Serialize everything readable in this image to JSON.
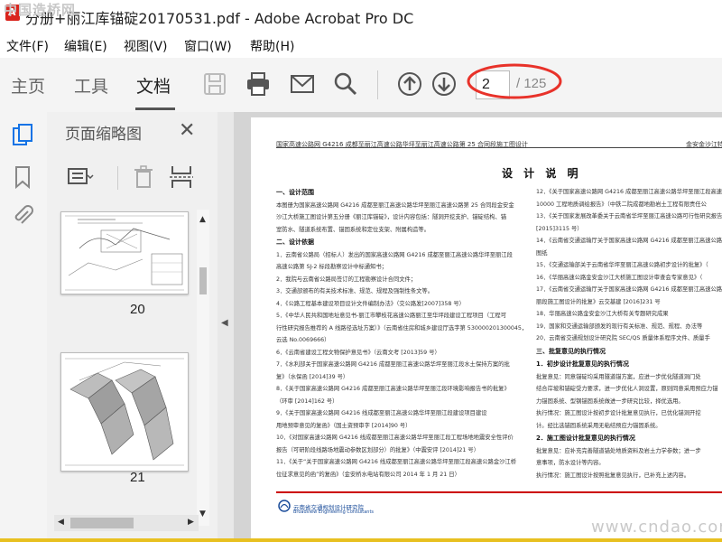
{
  "window": {
    "title": "分册+丽江库锚碇20170531.pdf - Adobe Acrobat Pro DC",
    "watermark_top": "中国造桥网",
    "watermark_bottom": "www.cndao.com"
  },
  "menu": [
    "文件(F)",
    "编辑(E)",
    "视图(V)",
    "窗口(W)",
    "帮助(H)"
  ],
  "tabs": [
    {
      "label": "主页",
      "active": false
    },
    {
      "label": "工具",
      "active": false
    },
    {
      "label": "文档",
      "active": true
    }
  ],
  "toolbar_icons": [
    "save-icon",
    "print-icon",
    "mail-icon",
    "search-icon",
    "page-up-icon",
    "page-down-icon"
  ],
  "page_nav": {
    "current": "2",
    "total_text": "/ 125"
  },
  "thumbnails": {
    "title": "页面缩略图",
    "pages": [
      "20",
      "21"
    ]
  },
  "document": {
    "header_left": "国家高速公路网 G4216 成都至丽江高速公路华坪至丽江高速公路第 25 合同段施工图设计",
    "header_right": "金安金沙江特",
    "title": "设 计 说 明",
    "left_col": [
      {
        "type": "head",
        "text": "一、设计范围"
      },
      {
        "type": "text",
        "text": "本图册为国家高速公路网 G4216 成都至丽江高速公路华坪至丽江高速公路第 25 合同段金安金"
      },
      {
        "type": "text",
        "text": "沙江大桥施工图设计第五分册《丽江库锚碇》，设计内容包括：隧洞开挖支护、锚碇结构、锚"
      },
      {
        "type": "text",
        "text": "室防水、隧道系统布置、锚固系统和定位支架、附属构造等。"
      },
      {
        "type": "head",
        "text": "二、设计依据"
      },
      {
        "type": "text",
        "text": "1．云南省公路局（招标人）发出的国家高速公路网 G4216 成都至丽江高速公路华坪至丽江段"
      },
      {
        "type": "text",
        "text": "高速公路第 SJ-2 标段勘察设计中标通知书；"
      },
      {
        "type": "text",
        "text": "2．我院与云南省公路局签订的工程勘察设计合同文件；"
      },
      {
        "type": "text",
        "text": "3．交通部颁布的有关技术标准、规范、规程及强制性条文等。"
      },
      {
        "type": "text",
        "text": "4．《公路工程基本建设项目设计文件编制办法》（交公路发[2007]358 号）"
      },
      {
        "type": "text",
        "text": "5．《中华人民共和国地址意见书-丽江市攀枝花高速公路丽江至华坪段建设工程项目（工程可"
      },
      {
        "type": "text",
        "text": "行性研究报告推荐的 A 线路径选址方案）》（云南省住房和城乡建设厅选字第 530000201300045，"
      },
      {
        "type": "text",
        "text": "云选 No.0069666）"
      },
      {
        "type": "text",
        "text": "6．《云南省建设工程文物保护意见书》（云南文考 [2013]59 号）"
      },
      {
        "type": "text",
        "text": "7．《水利部关于国家高速公路网 G4216 成都至丽江高速公路华坪至丽江段水土保持方案的批"
      },
      {
        "type": "text",
        "text": "复》（水保函 [2014]39 号）"
      },
      {
        "type": "text",
        "text": "8．《关于国家高速公路网 G4216 成都至丽江高速公路华坪至丽江段环境影响报告书的批复》"
      },
      {
        "type": "text",
        "text": "（环审 [2014]162 号）"
      },
      {
        "type": "text",
        "text": "9．《关于国家高速公路网 G4216 线成都至丽江高速公路华坪至丽江段建设项目建设"
      },
      {
        "type": "text",
        "text": "用地预审意见的复函》（国土资预审字 [2014]90 号）"
      },
      {
        "type": "text",
        "text": "10．《对国家高速公路网 G4216 线成都至丽江高速公路华坪至丽江段工程场地地震安全性评价"
      },
      {
        "type": "text",
        "text": "报告（可研阶段线路场地震动参数区划部分）的批复》（中震安评 [2014]21 号）"
      },
      {
        "type": "text",
        "text": "11．《关于“关于国家高速公路网 G4216 线成都至丽江高速公路华坪至丽江段高速公路金沙江桥"
      },
      {
        "type": "text",
        "text": "位征求意见的函”的复函》（金安桥水电站有限公司 2014 年 1 月 21 日）"
      }
    ],
    "right_col": [
      {
        "type": "text",
        "text": "12．《关于国家高速公路网 G4216 成都至丽江高速公路华坪至丽江段高速公路第 SJ-"
      },
      {
        "type": "text",
        "text": "10000 工程地质调绘报告》（中铁二院成都地勘岩土工程有限责任公"
      },
      {
        "type": "text",
        "text": "13．《关于国家发展改革委关于云南省华坪至丽江高速公路可行性研究报告（"
      },
      {
        "type": "text",
        "text": "[2015]3115 号）"
      },
      {
        "type": "text",
        "text": "14．《云南省交通运输厅关于国家高速公路网 G4216 成都至丽江高速公路华坪至"
      },
      {
        "type": "text",
        "text": "图纸"
      },
      {
        "type": "text",
        "text": "15．《交通运输部关于云南省华坪至丽江高速公路初步设计的批复》（"
      },
      {
        "type": "text",
        "text": "16．《华丽高速公路金安金沙江大桥施工图设计审查会专家意见》（"
      },
      {
        "type": "text",
        "text": "17．《云南省交通运输厅关于国家高速公路网 G4216 成都至丽江高速公路华坪至"
      },
      {
        "type": "text",
        "text": "丽段施工图设计的批复》云交基建 [2016]231 号"
      },
      {
        "type": "text",
        "text": "18．华丽高速公路金安金沙江大桥有关专题研究成果"
      },
      {
        "type": "text",
        "text": "19．国家和交通运输部颁发的现行有关标准、规范、规程、办法等"
      },
      {
        "type": "text",
        "text": "20．云南省交通规划设计研究院 SEC/QS 质量体系程序文件、质量手"
      },
      {
        "type": "head",
        "text": "三、批复意见的执行情况"
      },
      {
        "type": "head",
        "text": "1．初步设计批复意见的执行情况"
      },
      {
        "type": "text",
        "text": "批复意见：同意锚碇均采用隧道锚方案，应进一步优化隧道洞门处"
      },
      {
        "type": "text",
        "text": "结合岸坡和锚碇受力要求，进一步优化人洞设置，原则同意采用预应力锚"
      },
      {
        "type": "text",
        "text": "力锚固系统、型钢锚固系统做进一步研究比较，择优选用。"
      },
      {
        "type": "text",
        "text": "执行情况：施工图设计按初步设计批复意见执行，已优化锚洞开挖"
      },
      {
        "type": "text",
        "text": "计。经比选锚固系统采用无粘结预应力锚固系统。"
      },
      {
        "type": "head",
        "text": "2．施工图设计批复意见的执行情况"
      },
      {
        "type": "text",
        "text": "批复意见：应补充完善隧道锚处地质资料及岩土力学参数；进一步"
      },
      {
        "type": "text",
        "text": "意事项，防水设计等内容。"
      },
      {
        "type": "text",
        "text": "执行情况：施工图设计按照批复意见执行，已补充上述内容。"
      }
    ],
    "footer_org": "云南省交通规划设计研究院",
    "footer_org_en": "Broadview Engineering Consultants"
  },
  "colors": {
    "accent_red": "#d9251d",
    "annotation": "#e8322a",
    "footer_blue": "#1b4d9a"
  }
}
